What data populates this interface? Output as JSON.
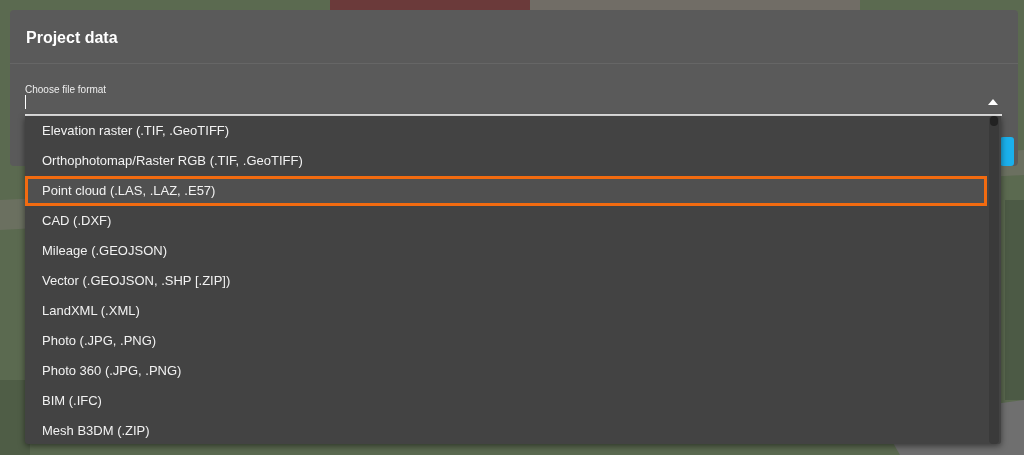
{
  "dialog": {
    "title": "Project data"
  },
  "format_field": {
    "label": "Choose file format",
    "expanded": true
  },
  "options": [
    {
      "label": "Elevation raster (.TIF, .GeoTIFF)",
      "highlighted": false
    },
    {
      "label": "Orthophotomap/Raster RGB (.TIF, .GeoTIFF)",
      "highlighted": false
    },
    {
      "label": "Point cloud (.LAS, .LAZ, .E57)",
      "highlighted": true
    },
    {
      "label": "CAD (.DXF)",
      "highlighted": false
    },
    {
      "label": "Mileage (.GEOJSON)",
      "highlighted": false
    },
    {
      "label": "Vector (.GEOJSON, .SHP [.ZIP])",
      "highlighted": false
    },
    {
      "label": "LandXML (.XML)",
      "highlighted": false
    },
    {
      "label": "Photo (.JPG, .PNG)",
      "highlighted": false
    },
    {
      "label": "Photo 360 (.JPG, .PNG)",
      "highlighted": false
    },
    {
      "label": "BIM (.IFC)",
      "highlighted": false
    },
    {
      "label": "Mesh B3DM (.ZIP)",
      "highlighted": false
    }
  ]
}
